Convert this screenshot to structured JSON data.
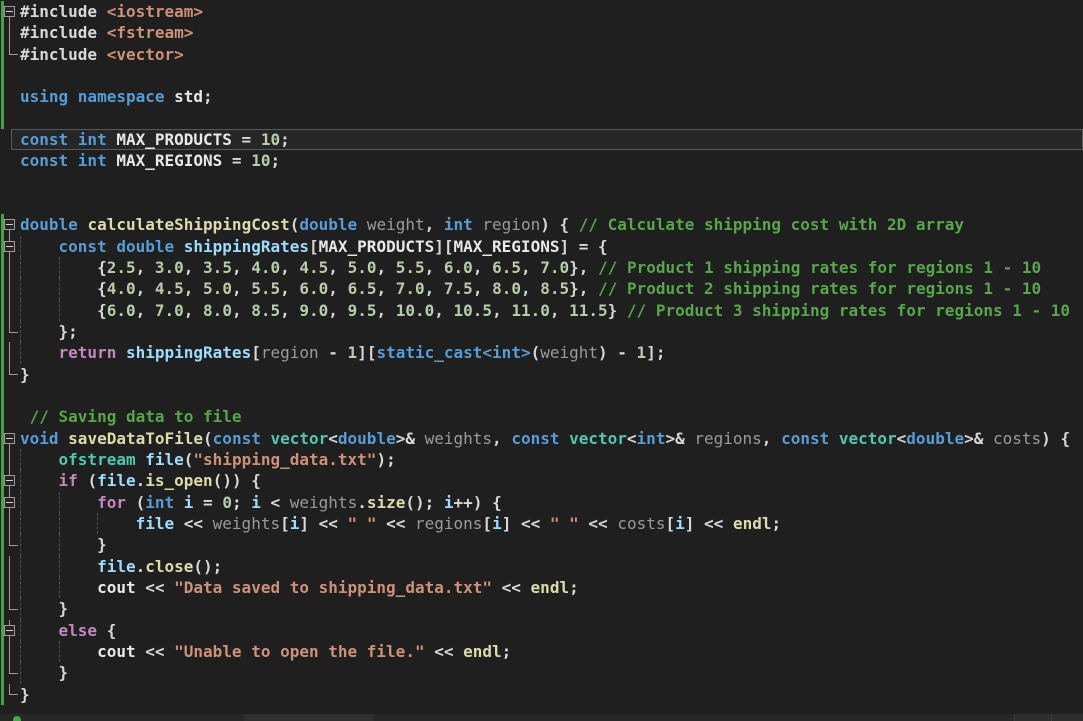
{
  "palette": {
    "bg": "#1f1f1f",
    "kw": "#569cd6",
    "ctrl": "#c586c0",
    "fn": "#dcdcaa",
    "type": "#4ec9b0",
    "var": "#9cdcfe",
    "id": "#9a9a9a",
    "num": "#b5cea8",
    "str": "#ce9178",
    "com": "#57a64a",
    "pun": "#d8d8d8",
    "wht": "#e8e8e8",
    "guide": "#4f4f4f",
    "fold": "#9b9b9b",
    "changeBar": "#45a247",
    "caretBorder": "#5a5a5a",
    "caretBg": "#262626",
    "scrollTrack": "#272727",
    "savedDot": "#3fae42"
  },
  "editor": {
    "language": "cpp",
    "lines": [
      {
        "f": "B",
        "m": true,
        "ind": 0,
        "tokens": [
          [
            "pun",
            "#include "
          ],
          [
            "str",
            "<iostream>"
          ]
        ]
      },
      {
        "f": "|",
        "m": true,
        "ind": 0,
        "tokens": [
          [
            "pun",
            "#include "
          ],
          [
            "str",
            "<fstream>"
          ]
        ]
      },
      {
        "f": "L",
        "m": true,
        "ind": 0,
        "tokens": [
          [
            "pun",
            "#include "
          ],
          [
            "str",
            "<vector>"
          ]
        ]
      },
      {
        "f": "",
        "m": true,
        "ind": 0,
        "tokens": []
      },
      {
        "f": "",
        "m": true,
        "ind": 0,
        "tokens": [
          [
            "kw",
            "using "
          ],
          [
            "kw",
            "namespace "
          ],
          [
            "wht",
            "std"
          ],
          [
            "pun",
            ";"
          ]
        ]
      },
      {
        "f": "",
        "m": true,
        "ind": 0,
        "tokens": []
      },
      {
        "f": "",
        "m": false,
        "ind": 0,
        "caret": true,
        "tokens": [
          [
            "kw",
            "const int "
          ],
          [
            "wht",
            "MAX_PRODUCTS"
          ],
          [
            "pun",
            " = "
          ],
          [
            "num",
            "10"
          ],
          [
            "pun",
            ";"
          ]
        ]
      },
      {
        "f": "",
        "m": false,
        "ind": 0,
        "tokens": [
          [
            "kw",
            "const int "
          ],
          [
            "wht",
            "MAX_REGIONS"
          ],
          [
            "pun",
            " = "
          ],
          [
            "num",
            "10"
          ],
          [
            "pun",
            ";"
          ]
        ]
      },
      {
        "f": "",
        "m": false,
        "ind": 0,
        "tokens": []
      },
      {
        "f": "",
        "m": false,
        "ind": 0,
        "tokens": []
      },
      {
        "f": "B",
        "m": true,
        "ind": 0,
        "tokens": [
          [
            "kw",
            "double "
          ],
          [
            "fn",
            "calculateShippingCost"
          ],
          [
            "pun",
            "("
          ],
          [
            "kw",
            "double "
          ],
          [
            "id",
            "weight"
          ],
          [
            "pun",
            ", "
          ],
          [
            "kw",
            "int "
          ],
          [
            "id",
            "region"
          ],
          [
            "pun",
            ") { "
          ],
          [
            "com",
            "// Calculate shipping cost with 2D array"
          ]
        ]
      },
      {
        "f": "Bn",
        "m": true,
        "ind": 4,
        "tokens": [
          [
            "pun",
            "    "
          ],
          [
            "kw",
            "const double "
          ],
          [
            "var",
            "shippingRates"
          ],
          [
            "pun",
            "["
          ],
          [
            "wht",
            "MAX_PRODUCTS"
          ],
          [
            "pun",
            "]["
          ],
          [
            "wht",
            "MAX_REGIONS"
          ],
          [
            "pun",
            "] = {"
          ]
        ]
      },
      {
        "f": "|",
        "m": true,
        "ind": 8,
        "tokens": [
          [
            "pun",
            "        {"
          ],
          [
            "num",
            "2.5"
          ],
          [
            "pun",
            ", "
          ],
          [
            "num",
            "3.0"
          ],
          [
            "pun",
            ", "
          ],
          [
            "num",
            "3.5"
          ],
          [
            "pun",
            ", "
          ],
          [
            "num",
            "4.0"
          ],
          [
            "pun",
            ", "
          ],
          [
            "num",
            "4.5"
          ],
          [
            "pun",
            ", "
          ],
          [
            "num",
            "5.0"
          ],
          [
            "pun",
            ", "
          ],
          [
            "num",
            "5.5"
          ],
          [
            "pun",
            ", "
          ],
          [
            "num",
            "6.0"
          ],
          [
            "pun",
            ", "
          ],
          [
            "num",
            "6.5"
          ],
          [
            "pun",
            ", "
          ],
          [
            "num",
            "7.0"
          ],
          [
            "pun",
            "}, "
          ],
          [
            "com",
            "// Product 1 shipping rates for regions 1 - 10"
          ]
        ]
      },
      {
        "f": "|",
        "m": true,
        "ind": 8,
        "tokens": [
          [
            "pun",
            "        {"
          ],
          [
            "num",
            "4.0"
          ],
          [
            "pun",
            ", "
          ],
          [
            "num",
            "4.5"
          ],
          [
            "pun",
            ", "
          ],
          [
            "num",
            "5.0"
          ],
          [
            "pun",
            ", "
          ],
          [
            "num",
            "5.5"
          ],
          [
            "pun",
            ", "
          ],
          [
            "num",
            "6.0"
          ],
          [
            "pun",
            ", "
          ],
          [
            "num",
            "6.5"
          ],
          [
            "pun",
            ", "
          ],
          [
            "num",
            "7.0"
          ],
          [
            "pun",
            ", "
          ],
          [
            "num",
            "7.5"
          ],
          [
            "pun",
            ", "
          ],
          [
            "num",
            "8.0"
          ],
          [
            "pun",
            ", "
          ],
          [
            "num",
            "8.5"
          ],
          [
            "pun",
            "}, "
          ],
          [
            "com",
            "// Product 2 shipping rates for regions 1 - 10"
          ]
        ]
      },
      {
        "f": "|",
        "m": true,
        "ind": 8,
        "tokens": [
          [
            "pun",
            "        {"
          ],
          [
            "num",
            "6.0"
          ],
          [
            "pun",
            ", "
          ],
          [
            "num",
            "7.0"
          ],
          [
            "pun",
            ", "
          ],
          [
            "num",
            "8.0"
          ],
          [
            "pun",
            ", "
          ],
          [
            "num",
            "8.5"
          ],
          [
            "pun",
            ", "
          ],
          [
            "num",
            "9.0"
          ],
          [
            "pun",
            ", "
          ],
          [
            "num",
            "9.5"
          ],
          [
            "pun",
            ", "
          ],
          [
            "num",
            "10.0"
          ],
          [
            "pun",
            ", "
          ],
          [
            "num",
            "10.5"
          ],
          [
            "pun",
            ", "
          ],
          [
            "num",
            "11.0"
          ],
          [
            "pun",
            ", "
          ],
          [
            "num",
            "11.5"
          ],
          [
            "pun",
            "} "
          ],
          [
            "com",
            "// Product 3 shipping rates for regions 1 - 10"
          ]
        ]
      },
      {
        "f": "L",
        "m": true,
        "ind": 4,
        "tokens": [
          [
            "pun",
            "    };"
          ]
        ]
      },
      {
        "f": "|",
        "m": true,
        "ind": 4,
        "tokens": [
          [
            "pun",
            "    "
          ],
          [
            "ctrl",
            "return "
          ],
          [
            "var",
            "shippingRates"
          ],
          [
            "pun",
            "["
          ],
          [
            "id",
            "region"
          ],
          [
            "pun",
            " - "
          ],
          [
            "num",
            "1"
          ],
          [
            "pun",
            "]["
          ],
          [
            "kw",
            "static_cast<int>"
          ],
          [
            "pun",
            "("
          ],
          [
            "id",
            "weight"
          ],
          [
            "pun",
            ") - "
          ],
          [
            "num",
            "1"
          ],
          [
            "pun",
            "];"
          ]
        ]
      },
      {
        "f": "L",
        "m": true,
        "ind": 0,
        "tokens": [
          [
            "pun",
            "}"
          ]
        ]
      },
      {
        "f": "",
        "m": true,
        "ind": 0,
        "tokens": []
      },
      {
        "f": "",
        "m": true,
        "ind": 1,
        "tokens": [
          [
            "com",
            " // Saving data to file"
          ]
        ]
      },
      {
        "f": "B",
        "m": true,
        "ind": 0,
        "tokens": [
          [
            "kw",
            "void "
          ],
          [
            "fn",
            "saveDataToFile"
          ],
          [
            "pun",
            "("
          ],
          [
            "kw",
            "const "
          ],
          [
            "type",
            "vector"
          ],
          [
            "pun",
            "<"
          ],
          [
            "kw",
            "double"
          ],
          [
            "pun",
            ">& "
          ],
          [
            "id",
            "weights"
          ],
          [
            "pun",
            ", "
          ],
          [
            "kw",
            "const "
          ],
          [
            "type",
            "vector"
          ],
          [
            "pun",
            "<"
          ],
          [
            "kw",
            "int"
          ],
          [
            "pun",
            ">& "
          ],
          [
            "id",
            "regions"
          ],
          [
            "pun",
            ", "
          ],
          [
            "kw",
            "const "
          ],
          [
            "type",
            "vector"
          ],
          [
            "pun",
            "<"
          ],
          [
            "kw",
            "double"
          ],
          [
            "pun",
            ">& "
          ],
          [
            "id",
            "costs"
          ],
          [
            "pun",
            ") {"
          ]
        ]
      },
      {
        "f": "|",
        "m": true,
        "ind": 4,
        "tokens": [
          [
            "pun",
            "    "
          ],
          [
            "type",
            "ofstream "
          ],
          [
            "var",
            "file"
          ],
          [
            "pun",
            "("
          ],
          [
            "str",
            "\"shipping_data.txt\""
          ],
          [
            "pun",
            ");"
          ]
        ]
      },
      {
        "f": "Bn",
        "m": true,
        "ind": 4,
        "tokens": [
          [
            "pun",
            "    "
          ],
          [
            "ctrl",
            "if "
          ],
          [
            "pun",
            "("
          ],
          [
            "var",
            "file"
          ],
          [
            "pun",
            "."
          ],
          [
            "fn",
            "is_open"
          ],
          [
            "pun",
            "()) {"
          ]
        ]
      },
      {
        "f": "Bn",
        "m": true,
        "ind": 8,
        "tokens": [
          [
            "pun",
            "        "
          ],
          [
            "ctrl",
            "for "
          ],
          [
            "pun",
            "("
          ],
          [
            "kw",
            "int "
          ],
          [
            "var",
            "i"
          ],
          [
            "pun",
            " = "
          ],
          [
            "num",
            "0"
          ],
          [
            "pun",
            "; "
          ],
          [
            "var",
            "i"
          ],
          [
            "pun",
            " < "
          ],
          [
            "id",
            "weights"
          ],
          [
            "pun",
            "."
          ],
          [
            "fn",
            "size"
          ],
          [
            "pun",
            "(); "
          ],
          [
            "var",
            "i"
          ],
          [
            "pun",
            "++) {"
          ]
        ]
      },
      {
        "f": "|",
        "m": true,
        "ind": 12,
        "tokens": [
          [
            "pun",
            "            "
          ],
          [
            "var",
            "file"
          ],
          [
            "pun",
            " << "
          ],
          [
            "id",
            "weights"
          ],
          [
            "pun",
            "["
          ],
          [
            "var",
            "i"
          ],
          [
            "pun",
            "] << "
          ],
          [
            "str",
            "\" \""
          ],
          [
            "pun",
            " << "
          ],
          [
            "id",
            "regions"
          ],
          [
            "pun",
            "["
          ],
          [
            "var",
            "i"
          ],
          [
            "pun",
            "] << "
          ],
          [
            "str",
            "\" \""
          ],
          [
            "pun",
            " << "
          ],
          [
            "id",
            "costs"
          ],
          [
            "pun",
            "["
          ],
          [
            "var",
            "i"
          ],
          [
            "pun",
            "] << "
          ],
          [
            "fn",
            "endl"
          ],
          [
            "pun",
            ";"
          ]
        ]
      },
      {
        "f": "L",
        "m": true,
        "ind": 8,
        "tokens": [
          [
            "pun",
            "        }"
          ]
        ]
      },
      {
        "f": "|",
        "m": true,
        "ind": 8,
        "tokens": [
          [
            "pun",
            "        "
          ],
          [
            "var",
            "file"
          ],
          [
            "pun",
            "."
          ],
          [
            "fn",
            "close"
          ],
          [
            "pun",
            "();"
          ]
        ]
      },
      {
        "f": "|",
        "m": true,
        "ind": 8,
        "tokens": [
          [
            "pun",
            "        "
          ],
          [
            "wht",
            "cout"
          ],
          [
            "pun",
            " << "
          ],
          [
            "str",
            "\"Data saved to shipping_data.txt\""
          ],
          [
            "pun",
            " << "
          ],
          [
            "fn",
            "endl"
          ],
          [
            "pun",
            ";"
          ]
        ]
      },
      {
        "f": "L",
        "m": true,
        "ind": 4,
        "tokens": [
          [
            "pun",
            "    }"
          ]
        ]
      },
      {
        "f": "Bn",
        "m": true,
        "ind": 4,
        "tokens": [
          [
            "pun",
            "    "
          ],
          [
            "ctrl",
            "else "
          ],
          [
            "pun",
            "{"
          ]
        ]
      },
      {
        "f": "|",
        "m": true,
        "ind": 8,
        "tokens": [
          [
            "pun",
            "        "
          ],
          [
            "wht",
            "cout"
          ],
          [
            "pun",
            " << "
          ],
          [
            "str",
            "\"Unable to open the file.\""
          ],
          [
            "pun",
            " << "
          ],
          [
            "fn",
            "endl"
          ],
          [
            "pun",
            ";"
          ]
        ]
      },
      {
        "f": "L",
        "m": true,
        "ind": 4,
        "tokens": [
          [
            "pun",
            "    }"
          ]
        ]
      },
      {
        "f": "L",
        "m": true,
        "ind": 0,
        "tokens": [
          [
            "pun",
            "}"
          ]
        ]
      }
    ]
  }
}
